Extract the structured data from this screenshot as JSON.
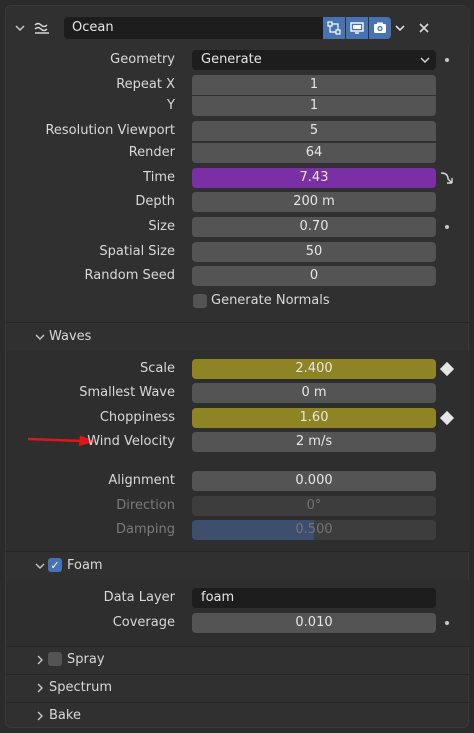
{
  "header": {
    "modifier_name": "Ocean",
    "icon": "ocean-wave-icon",
    "toggles": [
      "edit-mode-icon",
      "realtime-display-icon",
      "render-camera-icon"
    ]
  },
  "main": {
    "geometry": {
      "label": "Geometry",
      "value": "Generate"
    },
    "repeat_x": {
      "label": "Repeat X",
      "value": "1"
    },
    "repeat_y": {
      "label": "Y",
      "value": "1"
    },
    "resolution_viewport": {
      "label": "Resolution Viewport",
      "value": "5"
    },
    "render": {
      "label": "Render",
      "value": "64"
    },
    "time": {
      "label": "Time",
      "value": "7.43"
    },
    "depth": {
      "label": "Depth",
      "value": "200 m"
    },
    "size": {
      "label": "Size",
      "value": "0.70"
    },
    "spatial_size": {
      "label": "Spatial Size",
      "value": "50"
    },
    "random_seed": {
      "label": "Random Seed",
      "value": "0"
    },
    "generate_normals": {
      "label": "Generate Normals",
      "checked": false
    }
  },
  "waves": {
    "title": "Waves",
    "scale": {
      "label": "Scale",
      "value": "2.400"
    },
    "smallest_wave": {
      "label": "Smallest Wave",
      "value": "0 m"
    },
    "choppiness": {
      "label": "Choppiness",
      "value": "1.60"
    },
    "wind_velocity": {
      "label": "Wind Velocity",
      "value": "2 m/s"
    },
    "alignment": {
      "label": "Alignment",
      "value": "0.000"
    },
    "direction": {
      "label": "Direction",
      "value": "0°"
    },
    "damping": {
      "label": "Damping",
      "value": "0.500"
    }
  },
  "foam": {
    "title": "Foam",
    "enabled": true,
    "data_layer": {
      "label": "Data Layer",
      "value": "foam"
    },
    "coverage": {
      "label": "Coverage",
      "value": "0.010"
    }
  },
  "subpanels": {
    "spray": "Spray",
    "spectrum": "Spectrum",
    "bake": "Bake"
  },
  "colors": {
    "accent_blue": "#4772b3",
    "time_purple": "#7b2fa5",
    "keyframed_yellow": "#8f8423",
    "annotation_arrow": "#e0161b"
  }
}
